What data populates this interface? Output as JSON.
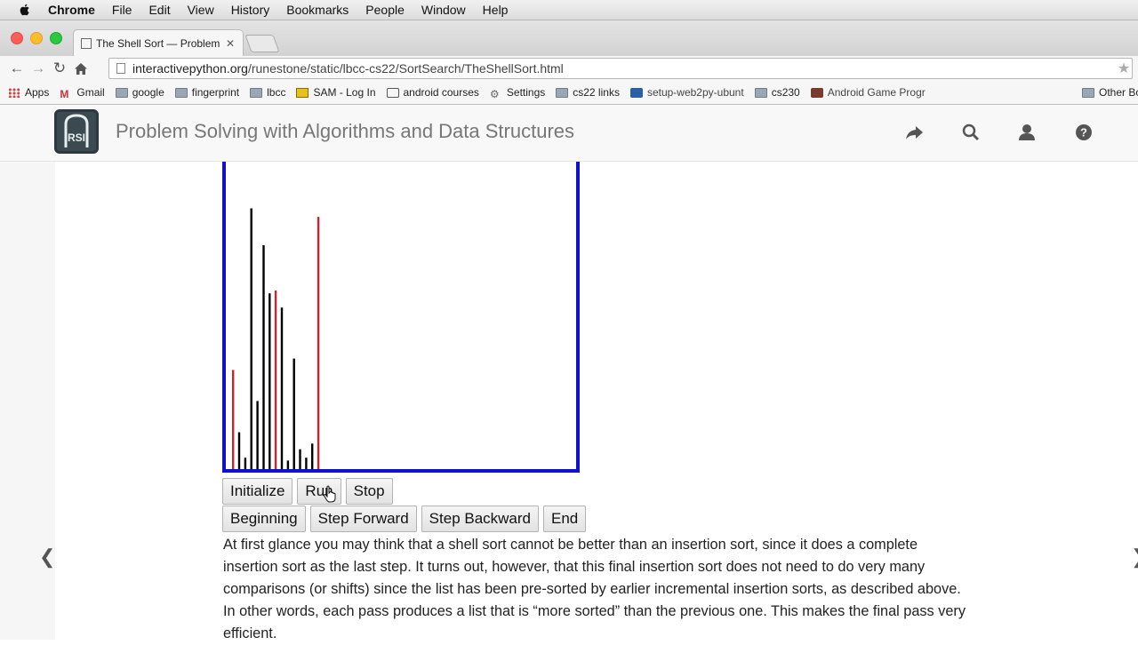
{
  "menubar": {
    "app": "Chrome",
    "items": [
      "File",
      "Edit",
      "View",
      "History",
      "Bookmarks",
      "People",
      "Window",
      "Help"
    ]
  },
  "browser": {
    "tab_title": "The Shell Sort — Problem",
    "url_host": "interactivepython.org",
    "url_path": "/runestone/static/lbcc-cs22/SortSearch/TheShellSort.html"
  },
  "bookmarks": [
    {
      "label": "Apps",
      "icon": "apps-grid-icon"
    },
    {
      "label": "Gmail",
      "icon": "gmail-icon"
    },
    {
      "label": "google",
      "icon": "folder-icon"
    },
    {
      "label": "fingerprint",
      "icon": "folder-icon"
    },
    {
      "label": "lbcc",
      "icon": "folder-icon"
    },
    {
      "label": "SAM - Log In",
      "icon": "sam-icon"
    },
    {
      "label": "android courses",
      "icon": "android-icon"
    },
    {
      "label": "Settings",
      "icon": "gear-icon"
    },
    {
      "label": "cs22 links",
      "icon": "folder-icon"
    },
    {
      "label": "setup-web2py-ubunt",
      "icon": "web2py-icon"
    },
    {
      "label": "cs230",
      "icon": "folder-icon"
    },
    {
      "label": "Android Game Progr",
      "icon": "game-icon"
    }
  ],
  "bookmarks_other": "Other Boo",
  "site": {
    "logo_text": "RSI",
    "title": "Problem Solving with Algorithms and Data Structures"
  },
  "chart_data": {
    "type": "bar",
    "note_colors": {
      "frame": "#1010d0",
      "normal": "#000000",
      "highlight": "#cc2233"
    },
    "values": [
      35,
      13,
      4,
      92,
      24,
      79,
      62,
      63,
      57,
      3,
      39,
      7,
      4,
      9,
      89
    ],
    "highlighted": [
      0,
      7,
      14
    ],
    "ylim": [
      0,
      100
    ]
  },
  "controls": {
    "initialize": "Initialize",
    "run": "Run",
    "stop": "Stop",
    "beginning": "Beginning",
    "step_forward": "Step Forward",
    "step_backward": "Step Backward",
    "end": "End"
  },
  "content": {
    "paragraph": "At first glance you may think that a shell sort cannot be better than an insertion sort, since it does a complete insertion sort as the last step. It turns out, however, that this final insertion sort does not need to do very many comparisons (or shifts) since the list has been pre-sorted by earlier incremental insertion sorts, as described above. In other words, each pass produces a list that is “more sorted” than the previous one. This makes the final pass very efficient."
  }
}
